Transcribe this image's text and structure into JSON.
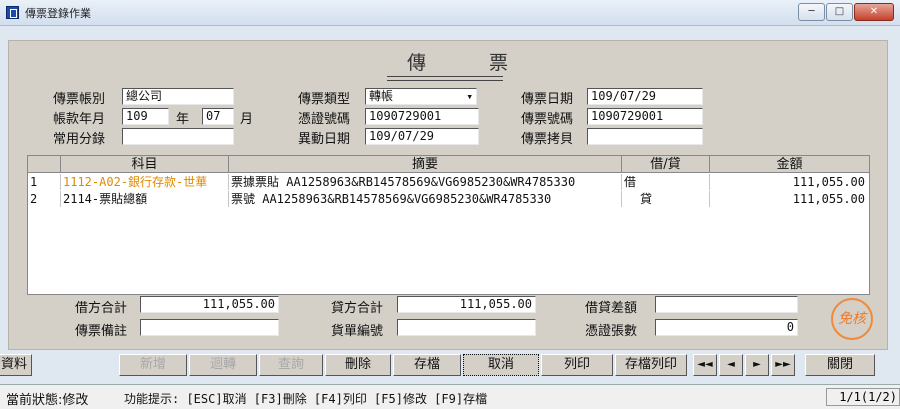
{
  "window": {
    "title": "傳票登錄作業",
    "controls": [
      "minimize-icon",
      "maximize-icon",
      "close-icon"
    ]
  },
  "header": {
    "title": "傳　票",
    "account": {
      "label": "傳票帳別",
      "value": "總公司"
    },
    "period": {
      "label": "帳款年月",
      "year": "109",
      "year_unit": "年",
      "month": "07",
      "month_unit": "月"
    },
    "common_entry": {
      "label": "常用分錄",
      "value": ""
    },
    "voucher_type": {
      "label": "傳票類型",
      "value": "轉帳"
    },
    "evidence_no": {
      "label": "憑證號碼",
      "value": "1090729001"
    },
    "change_date": {
      "label": "異動日期",
      "value": "109/07/29"
    },
    "voucher_date": {
      "label": "傳票日期",
      "value": "109/07/29"
    },
    "voucher_no": {
      "label": "傳票號碼",
      "value": "1090729001"
    },
    "voucher_copy": {
      "label": "傳票拷貝",
      "value": ""
    }
  },
  "grid": {
    "columns": [
      "科目",
      "摘要",
      "借/貸",
      "金額"
    ],
    "rows": [
      {
        "index": "1",
        "account": "1112-A02-銀行存款-世華",
        "memo": "票據票貼 AA1258963&RB14578569&VG6985230&WR4785330",
        "side": "借",
        "amount": "111,055.00"
      },
      {
        "index": "2",
        "account": "2114-票貼總額",
        "memo": "票號 AA1258963&RB14578569&VG6985230&WR4785330",
        "side": "貸",
        "amount": "111,055.00"
      }
    ]
  },
  "footer": {
    "debit_total": {
      "label": "借方合計",
      "value": "111,055.00"
    },
    "credit_total": {
      "label": "貸方合計",
      "value": "111,055.00"
    },
    "difference": {
      "label": "借貸差額",
      "value": ""
    },
    "remark": {
      "label": "傳票備註",
      "value": ""
    },
    "document_no": {
      "label": "貨單編號",
      "value": ""
    },
    "evidence_count": {
      "label": "憑證張數",
      "value": "0"
    },
    "stamp": "免核"
  },
  "toolbar": {
    "left_partial": "資料",
    "add": "新增",
    "reverse": "迴轉",
    "query": "查詢",
    "delete": "刪除",
    "save": "存檔",
    "cancel": "取消",
    "print": "列印",
    "save_print": "存檔列印",
    "first": "◄◄",
    "prev": "◄",
    "next": "►",
    "last": "►►",
    "close": "關閉"
  },
  "status": {
    "state": "當前狀態:修改",
    "hint": "功能提示: [ESC]取消 [F3]刪除 [F4]列印 [F5]修改 [F9]存檔",
    "page": "1/1(1/2)"
  },
  "colors": {
    "accent": "#e08a00",
    "stamp": "#f07a2a",
    "panel": "#d4d0c8"
  }
}
